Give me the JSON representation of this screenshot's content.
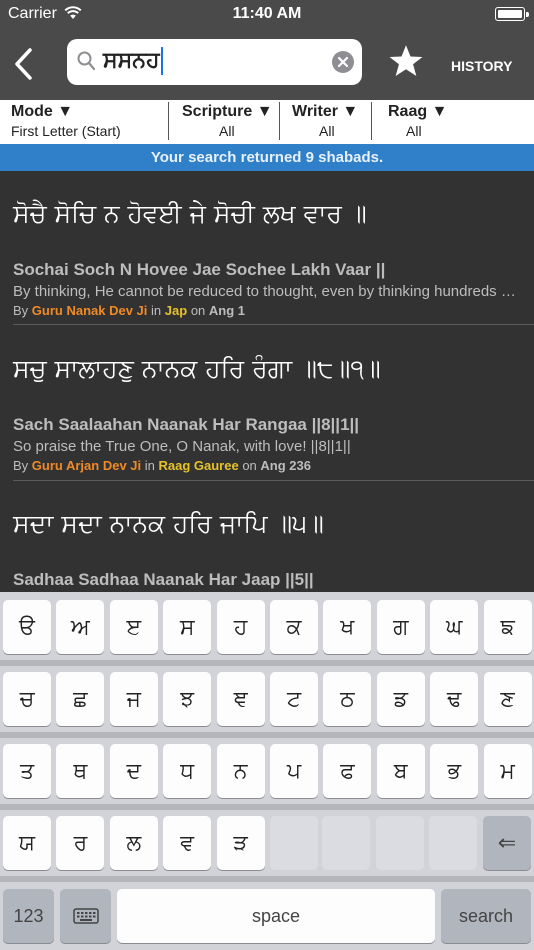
{
  "status": {
    "carrier": "Carrier",
    "time": "11:40 AM"
  },
  "nav": {
    "search_query": "ਸਸਨਹ",
    "history_label": "HISTORY"
  },
  "filters": {
    "mode": {
      "label": "Mode ▼",
      "value": "First Letter (Start)"
    },
    "scripture": {
      "label": "Scripture ▼",
      "value": "All"
    },
    "writer": {
      "label": "Writer ▼",
      "value": "All"
    },
    "raag": {
      "label": "Raag ▼",
      "value": "All"
    }
  },
  "result_banner": "Your search returned 9 shabads.",
  "results": [
    {
      "gurmukhi": "ਸੋਚੈ ਸੋਚਿ ਨ ਹੋਵਈ ਜੇ ਸੋਚੀ ਲਖ ਵਾਰ ॥",
      "transliteration": "Sochai Soch N Hovee Jae Sochee Lakh Vaar ||",
      "translation": "By thinking, He cannot be reduced to thought, even by thinking hundreds of thousands of times.",
      "by": "By",
      "writer": "Guru Nanak Dev Ji",
      "in": "in",
      "scripture": "Jap",
      "on": "on",
      "ang": "Ang 1"
    },
    {
      "gurmukhi": "ਸਚੁ ਸਾਲਾਹਣੁ ਨਾਨਕ ਹਰਿ ਰੰਗਾ ॥੮॥੧॥",
      "transliteration": "Sach Saalaahan Naanak Har Rangaa ||8||1||",
      "translation": "So praise the True One, O Nanak, with love! ||8||1||",
      "by": "By",
      "writer": "Guru Arjan Dev Ji",
      "in": "in",
      "scripture": "Raag Gauree",
      "on": "on",
      "ang": "Ang 236"
    },
    {
      "gurmukhi": "ਸਦਾ ਸਦਾ ਨਾਨਕ ਹਰਿ ਜਾਪਿ ॥੫॥",
      "transliteration": "Sadhaa Sadhaa Naanak Har Jaap ||5||"
    }
  ],
  "keyboard": {
    "rows": [
      [
        "ੳ",
        "ਅ",
        "ੲ",
        "ਸ",
        "ਹ",
        "ਕ",
        "ਖ",
        "ਗ",
        "ਘ",
        "ਙ"
      ],
      [
        "ਚ",
        "ਛ",
        "ਜ",
        "ਝ",
        "ਞ",
        "ਟ",
        "ਠ",
        "ਡ",
        "ਢ",
        "ਣ"
      ],
      [
        "ਤ",
        "ਥ",
        "ਦ",
        "ਧ",
        "ਨ",
        "ਪ",
        "ਫ",
        "ਬ",
        "ਭ",
        "ਮ"
      ],
      [
        "ਯ",
        "ਰ",
        "ਲ",
        "ਵ",
        "ੜ"
      ]
    ],
    "delete_glyph": "⇐",
    "numbers_label": "123",
    "space_label": "space",
    "search_label": "search"
  },
  "colors": {
    "nav_bg": "#4a4a4a",
    "banner_bg": "#2f80c9",
    "results_bg": "#323232",
    "writer": "#f08a24",
    "scripture": "#e6c229"
  }
}
